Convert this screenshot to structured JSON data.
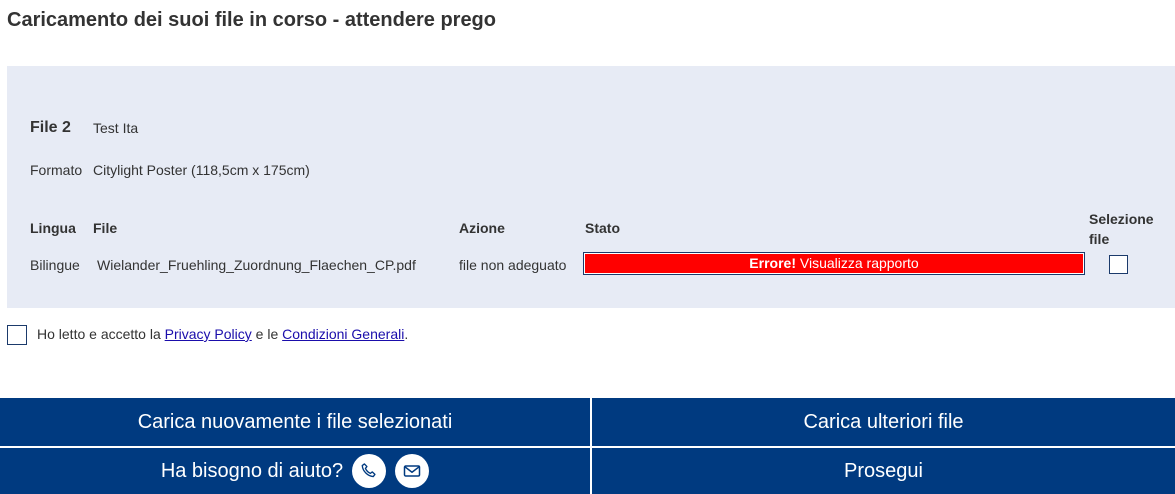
{
  "page": {
    "title": "Caricamento dei suoi file in corso - attendere prego"
  },
  "file_block": {
    "label": "File 2",
    "name": "Test Ita",
    "format_label": "Formato",
    "format_value": "Citylight Poster (118,5cm x 175cm)"
  },
  "table": {
    "headers": {
      "lingua": "Lingua",
      "file": "File",
      "azione": "Azione",
      "stato": "Stato",
      "selezione": "Selezione file"
    },
    "row": {
      "lingua": "Bilingue",
      "file": "Wielander_Fruehling_Zuordnung_Flaechen_CP.pdf",
      "azione": "file non adeguato",
      "status_error": "Errore!",
      "status_link": "Visualizza rapporto",
      "status_color": "#ff0000"
    }
  },
  "consent": {
    "text_before": "Ho letto e accetto la ",
    "privacy_link": "Privacy Policy",
    "text_mid": " e le ",
    "terms_link": "Condizioni Generali",
    "text_after": "."
  },
  "buttons": {
    "reload": "Carica nuovamente i file selezionati",
    "upload_more": "Carica ulteriori file",
    "help": "Ha bisogno di aiuto?",
    "next": "Prosegui",
    "help_icons": [
      "phone-icon",
      "mail-icon"
    ]
  },
  "colors": {
    "primary": "#003a80",
    "panel": "#e7ebf5",
    "error": "#ff0000"
  }
}
